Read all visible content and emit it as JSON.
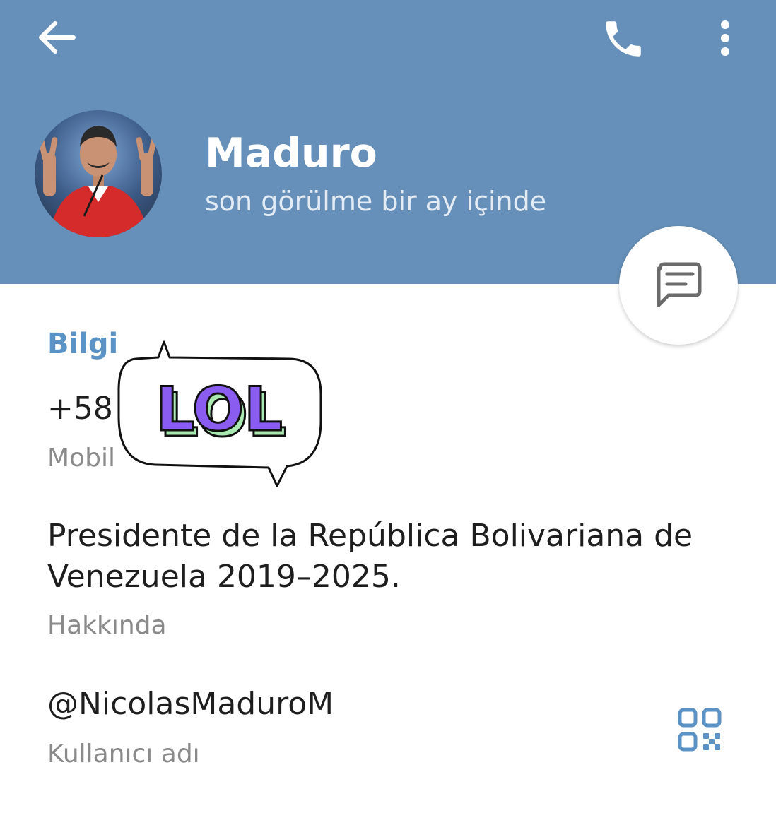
{
  "header": {
    "name": "Maduro",
    "status": "son görülme bir ay içinde",
    "back_icon": "arrow-left-icon",
    "call_icon": "phone-icon",
    "menu_icon": "more-vertical-icon",
    "background_color": "#6690b9"
  },
  "avatar": {
    "description": "profile-photo"
  },
  "fab": {
    "icon": "message-icon"
  },
  "info": {
    "section_title": "Bilgi",
    "phone_value": "+58",
    "phone_label": "Mobil",
    "bio_value": "Presidente de la República Bolivariana de Venezuela 2019–2025.",
    "bio_label": "Hakkında",
    "username_value": "@NicolasMaduroM",
    "username_label": "Kullanıcı adı",
    "qr_icon": "qr-code-icon",
    "accent_color": "#5b93c6"
  },
  "sticker": {
    "text": "LOL"
  }
}
